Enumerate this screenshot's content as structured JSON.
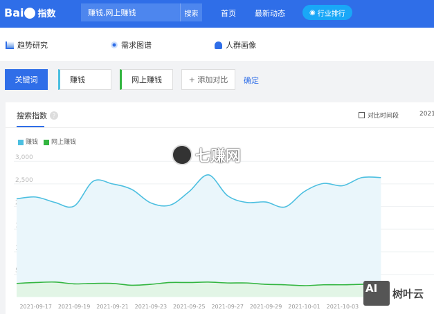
{
  "header": {
    "logo_text": "Bai",
    "logo_suffix": "指数",
    "search_value": "赚钱,网上赚钱",
    "search_button": "搜索",
    "nav": [
      "首页",
      "最新动态"
    ],
    "rank_button": "行业排行"
  },
  "subnav": [
    "趋势研究",
    "需求图谱",
    "人群画像"
  ],
  "keywords": {
    "label": "关键词",
    "items": [
      "赚钱",
      "网上赚钱"
    ],
    "add": "+ 添加对比",
    "confirm": "确定"
  },
  "panel": {
    "title": "搜索指数",
    "compare": "对比时间段",
    "year": "2021"
  },
  "watermarks": [
    "七赚网",
    "树叶云"
  ],
  "colors": {
    "series1": "#4cbfe0",
    "series2": "#33b540",
    "accent": "#2f6ee8"
  },
  "chart_data": {
    "type": "area",
    "title": "搜索指数",
    "ylim": [
      0,
      3000
    ],
    "yticks": [
      "3,000",
      "2,500",
      "2,000",
      "1,500",
      "1,000",
      "500"
    ],
    "x": [
      "2021-09-16",
      "2021-09-17",
      "2021-09-18",
      "2021-09-19",
      "2021-09-20",
      "2021-09-21",
      "2021-09-22",
      "2021-09-23",
      "2021-09-24",
      "2021-09-25",
      "2021-09-26",
      "2021-09-27",
      "2021-09-28",
      "2021-09-29",
      "2021-09-30",
      "2021-10-01",
      "2021-10-02",
      "2021-10-03",
      "2021-10-04",
      "2021-10-05"
    ],
    "xtick_labels": [
      "2021-09-17",
      "2021-09-19",
      "2021-09-21",
      "2021-09-23",
      "2021-09-25",
      "2021-09-27",
      "2021-09-29",
      "2021-10-01",
      "2021-10-03"
    ],
    "series": [
      {
        "name": "赚钱",
        "values": [
          2170,
          2210,
          2090,
          2010,
          2560,
          2500,
          2380,
          2080,
          2030,
          2330,
          2700,
          2240,
          2090,
          2100,
          1990,
          2330,
          2510,
          2460,
          2640,
          2640
        ]
      },
      {
        "name": "网上赚钱",
        "values": [
          300,
          320,
          330,
          290,
          300,
          300,
          260,
          280,
          320,
          320,
          330,
          310,
          310,
          280,
          270,
          250,
          270,
          270,
          280,
          290
        ]
      }
    ],
    "legend": "top-left",
    "grid": true
  }
}
